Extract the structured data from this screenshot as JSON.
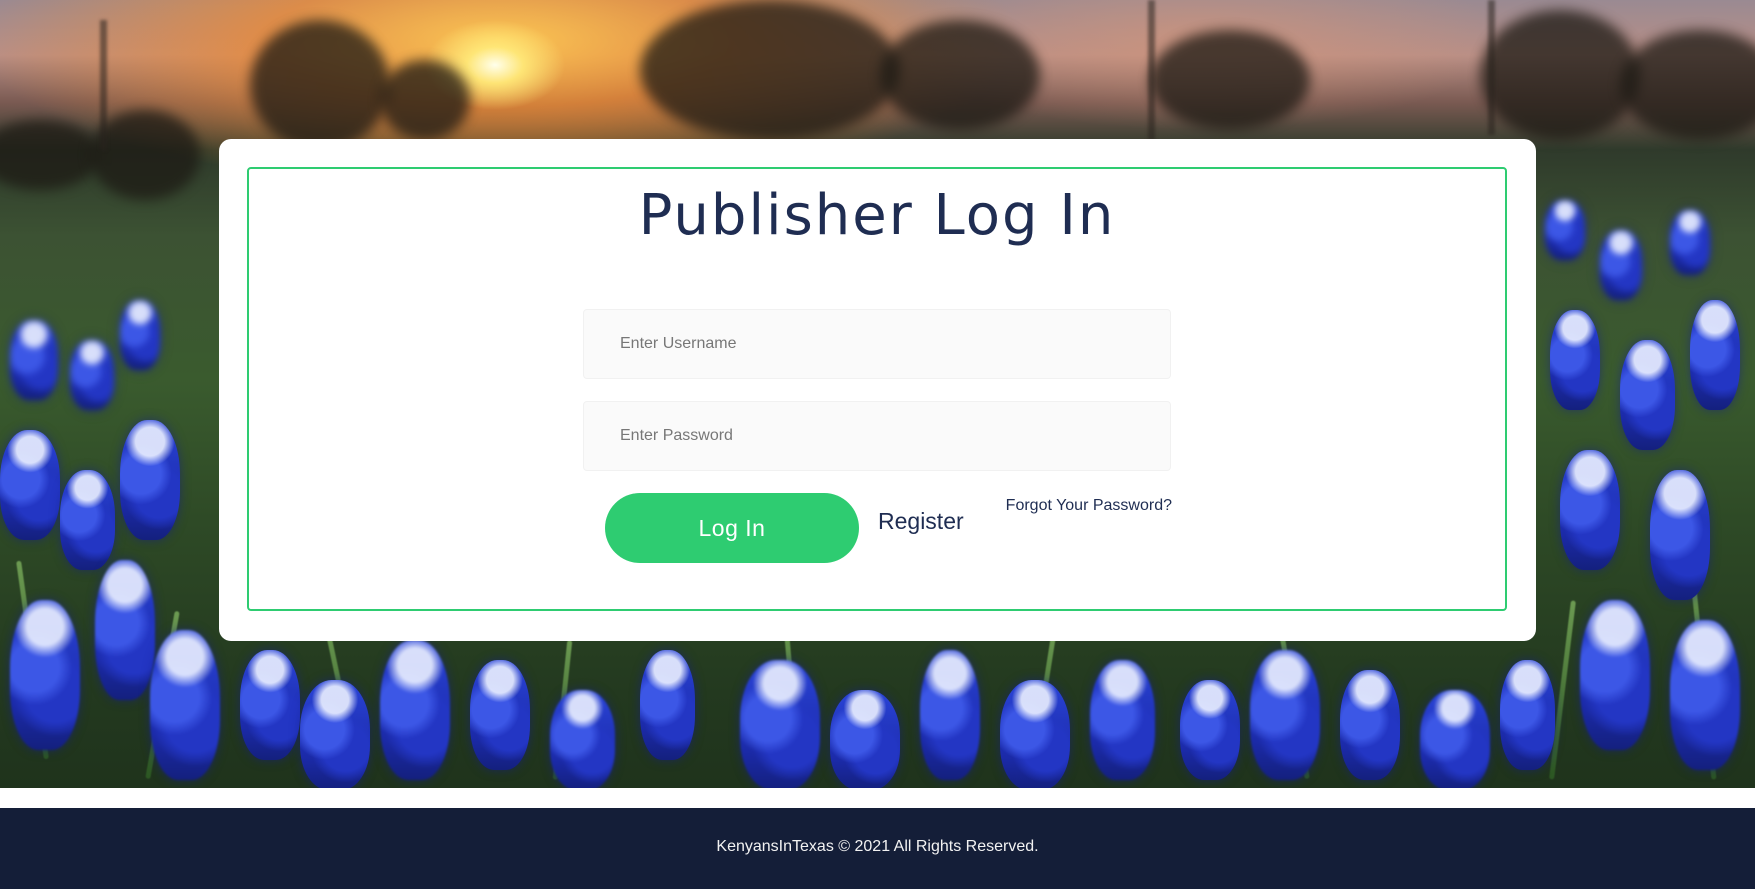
{
  "login": {
    "title": "Publisher Log In",
    "username_placeholder": "Enter Username",
    "password_placeholder": "Enter Password",
    "login_label": "Log In",
    "register_label": "Register",
    "forgot_label": "Forgot Your Password?"
  },
  "footer": {
    "text": "KenyansInTexas © 2021 All Rights Reserved."
  },
  "colors": {
    "accent": "#2ecc71",
    "title_text": "#1f2d52",
    "footer_background": "#141e38"
  }
}
